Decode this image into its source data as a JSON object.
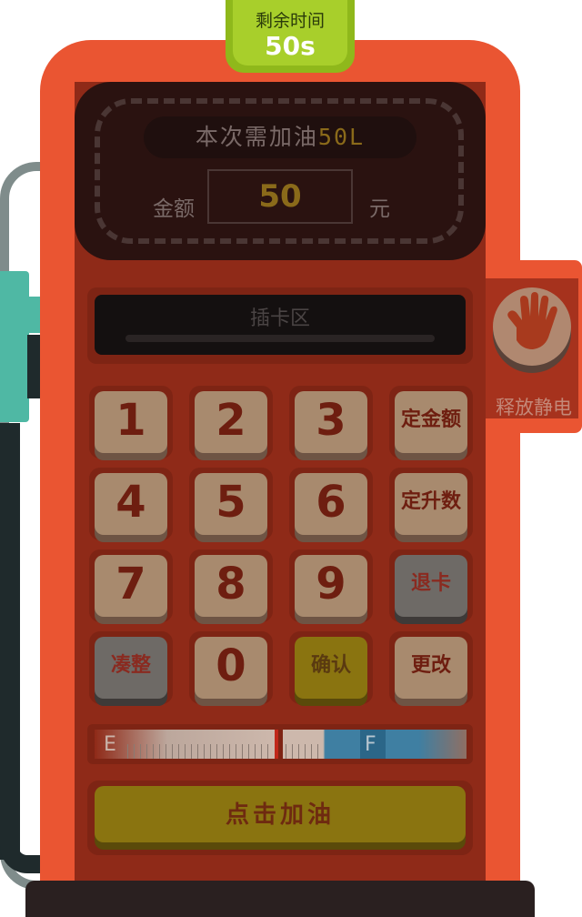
{
  "timer": {
    "label": "剩余时间",
    "value": "50s"
  },
  "display": {
    "need_prefix": "本次需加油",
    "need_amount": "50L",
    "amount_label": "金额",
    "amount_value": "50",
    "unit_label": "元"
  },
  "card_slot": {
    "label": "插卡区"
  },
  "static_release": {
    "label": "释放静电",
    "icon": "hand-icon"
  },
  "keypad": {
    "k1": "1",
    "k2": "2",
    "k3": "3",
    "fixed_amount": "定金额",
    "k4": "4",
    "k5": "5",
    "k6": "6",
    "fixed_liters": "定升数",
    "k7": "7",
    "k8": "8",
    "k9": "9",
    "eject_card": "退卡",
    "round_up": "凑整",
    "k0": "0",
    "confirm": "确认",
    "modify": "更改"
  },
  "gauge": {
    "empty_label": "E",
    "full_label": "F"
  },
  "fuel_button": {
    "label": "点击加油"
  },
  "colors": {
    "pump_body": "#ea5532",
    "panel": "#8f2a18",
    "timer_green": "#a8cf2b",
    "key_beige": "#a88a6e",
    "key_yellow": "#8a7410",
    "key_gray": "#6e6a66",
    "nozzle_teal": "#4fb8a4"
  }
}
